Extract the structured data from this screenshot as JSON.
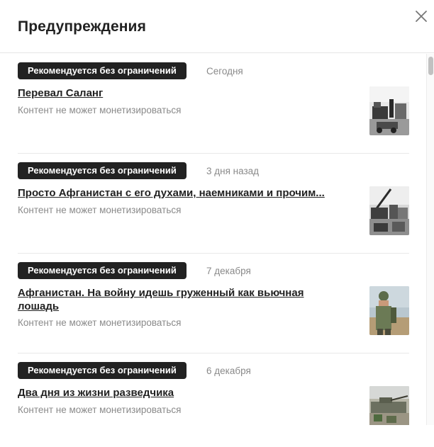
{
  "dialog": {
    "title": "Предупреждения"
  },
  "items": [
    {
      "badge": "Рекомендуется без ограничений",
      "date": "Сегодня",
      "title": "Перевал Саланг",
      "subtitle": "Контент не может монетизироваться"
    },
    {
      "badge": "Рекомендуется без ограничений",
      "date": "3 дня назад",
      "title": "Просто Афганистан с его духами, наемниками и прочим...",
      "subtitle": "Контент не может монетизироваться"
    },
    {
      "badge": "Рекомендуется без ограничений",
      "date": "7 декабря",
      "title": "Афганистан. На войну идешь груженный как вьючная лошадь",
      "subtitle": "Контент не может монетизироваться"
    },
    {
      "badge": "Рекомендуется без ограничений",
      "date": "6 декабря",
      "title": "Два дня из жизни разведчика",
      "subtitle": "Контент не может монетизироваться"
    }
  ]
}
